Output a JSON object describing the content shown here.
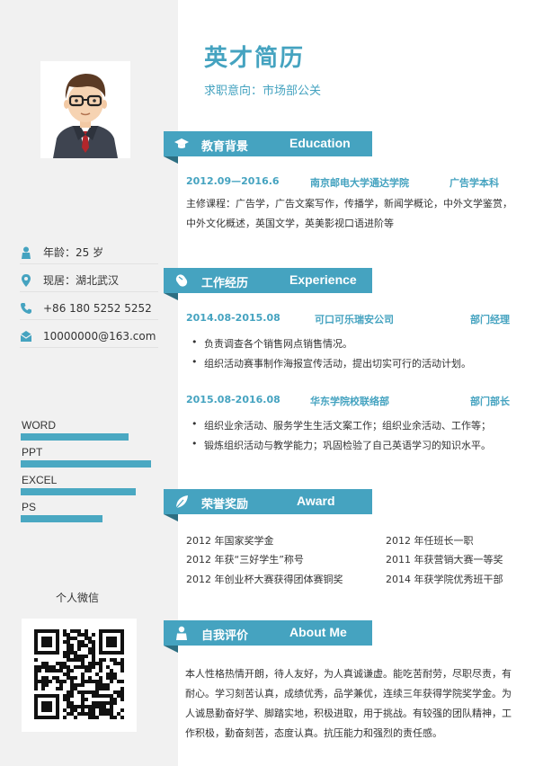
{
  "resume": {
    "name": "英才简历",
    "intent": "求职意向：市场部公关"
  },
  "sidebar": {
    "age": "年龄：25 岁",
    "location": "现居：湖北武汉",
    "phone": "+86 180 5252 5252",
    "email": "10000000@163.com",
    "skills": [
      {
        "label": "WORD",
        "level": 0.82
      },
      {
        "label": "PPT",
        "level": 0.99
      },
      {
        "label": "EXCEL",
        "level": 0.88
      },
      {
        "label": "PS",
        "level": 0.62
      }
    ],
    "wechat_title": "个人微信"
  },
  "education": {
    "title_zh": "教育背景",
    "title_en": "Education",
    "period": "2012.09—2016.6",
    "school": "南京邮电大学通达学院",
    "degree": "广告学本科",
    "courses_line1": "主修课程：广告学，广告文案写作，传播学，新闻学概论，中外文学鉴赏，",
    "courses_line2": "中外文化概述，英国文学，英美影视口语进阶等"
  },
  "work": {
    "title_zh": "工作经历",
    "title_en": "Experience",
    "jobs": [
      {
        "period": "2014.08-2015.08",
        "company": "可口可乐瑞安公司",
        "role": "部门经理",
        "bullets": [
          "负责调查各个销售网点销售情况。",
          "组织活动赛事制作海报宣传活动，提出切实可行的活动计划。"
        ]
      },
      {
        "period": "2015.08-2016.08",
        "company": "华东学院校联络部",
        "role": "部门部长",
        "bullets": [
          "组织业余活动、服务学生生活文案工作；组织业余活动、工作等；",
          "锻炼组织活动与教学能力；巩固检验了自己英语学习的知识水平。"
        ]
      }
    ]
  },
  "awards": {
    "title_zh": "荣誉奖励",
    "title_en": "Award",
    "items": [
      "2012 年国家奖学金",
      "2012 年任班长一职",
      "2012 年获“三好学生”称号",
      "2011 年获营销大赛一等奖",
      "2012 年创业杯大赛获得团体赛铜奖",
      "2014 年获学院优秀班干部"
    ]
  },
  "about": {
    "title_zh": "自我评价",
    "title_en": "About Me",
    "text": "本人性格热情开朗，待人友好，为人真诚谦虚。能吃苦耐劳，尽职尽责，有耐心。学习刻苦认真，成绩优秀，品学兼优，连续三年获得学院奖学金。为人诚恳勤奋好学、脚踏实地，积极进取，用于挑战。有较强的团队精神，工作积极，勤奋刻苦，态度认真。抗压能力和强烈的责任感。"
  },
  "colors": {
    "accent": "#45a3c0",
    "accent_dark": "#2d6f82",
    "sidebar_bg": "#f1f1f1"
  }
}
